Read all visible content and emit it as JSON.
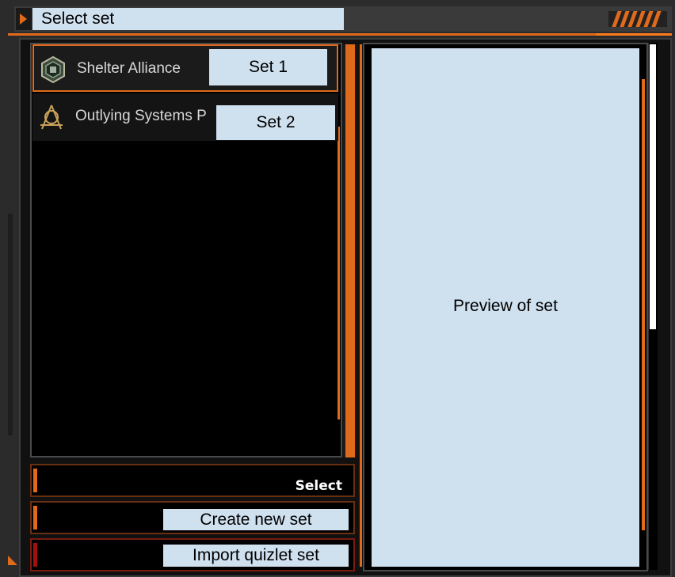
{
  "window": {
    "title": "Select set"
  },
  "sets": [
    {
      "name": "Shelter Alliance",
      "tag": "Set 1",
      "icon": "hex-emblem-icon"
    },
    {
      "name": "Outlying Systems P",
      "tag": "Set 2",
      "icon": "tripod-emblem-icon"
    }
  ],
  "buttons": {
    "select": "Select",
    "create": "Create new set",
    "import": "Import quizlet set"
  },
  "preview": {
    "label": "Preview of set"
  },
  "colors": {
    "accent": "#e06a1c",
    "placeholder": "#cfe0ef",
    "background": "#111111"
  }
}
